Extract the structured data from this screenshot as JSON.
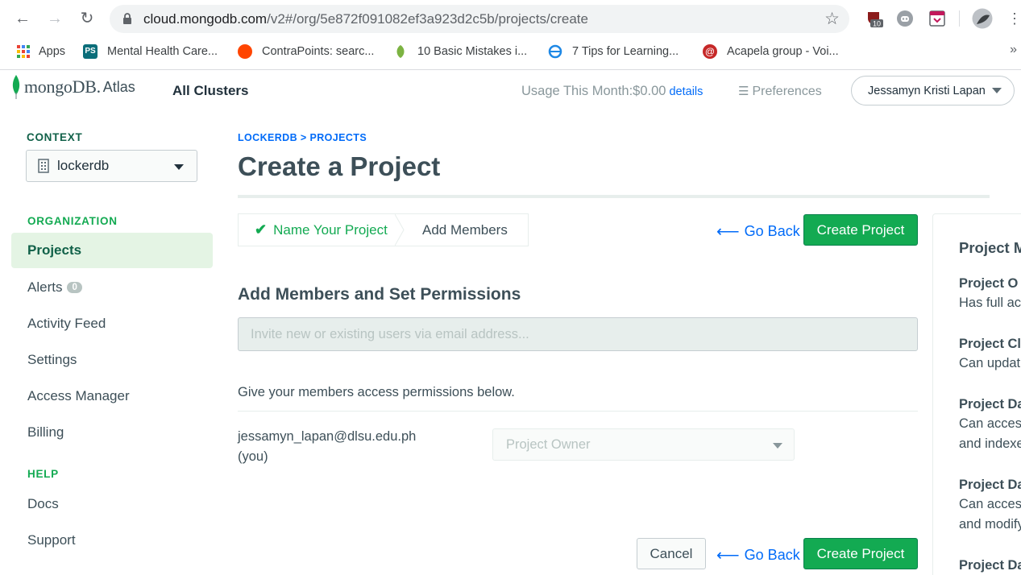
{
  "browser": {
    "url_host": "cloud.mongodb.com",
    "url_path": "/v2#/org/5e872f091082ef3a923d2c5b/projects/create",
    "ext_badge": "10",
    "bookmarks": [
      {
        "label": "Apps",
        "icon": "apps-grid-icon",
        "color": "#ea4335"
      },
      {
        "label": "Mental Health Care...",
        "icon": "ps-icon",
        "color": "#0b6e7a"
      },
      {
        "label": "ContraPoints: searc...",
        "icon": "reddit-icon",
        "color": "#ff4500"
      },
      {
        "label": "10 Basic Mistakes i...",
        "icon": "leaf-icon",
        "color": "#7cb342"
      },
      {
        "label": "7 Tips for Learning...",
        "icon": "globe-icon",
        "color": "#1e88e5"
      },
      {
        "label": "Acapela group - Voi...",
        "icon": "acapela-icon",
        "color": "#c62828"
      }
    ]
  },
  "header": {
    "logo_text": "mongoDB.",
    "logo_sub": "Atlas",
    "all_clusters": "All Clusters",
    "usage_label": "Usage This Month:$0.00",
    "usage_link": "details",
    "preferences": "Preferences",
    "user_name": "Jessamyn Kristi Lapan"
  },
  "sidebar": {
    "context_label": "CONTEXT",
    "org_name": "lockerdb",
    "organization_label": "ORGANIZATION",
    "items": [
      {
        "label": "Projects",
        "active": true
      },
      {
        "label": "Alerts",
        "badge": "0"
      },
      {
        "label": "Activity Feed"
      },
      {
        "label": "Settings"
      },
      {
        "label": "Access Manager"
      },
      {
        "label": "Billing"
      }
    ],
    "help_label": "HELP",
    "help_items": [
      {
        "label": "Docs"
      },
      {
        "label": "Support"
      }
    ]
  },
  "main": {
    "breadcrumb": "LOCKERDB > PROJECTS",
    "title": "Create a Project",
    "steps": [
      {
        "label": "Name Your Project",
        "done": true
      },
      {
        "label": "Add Members",
        "done": false
      }
    ],
    "go_back": "Go Back",
    "create_project": "Create Project",
    "cancel": "Cancel",
    "section_title": "Add Members and Set Permissions",
    "invite_placeholder": "Invite new or existing users via email address...",
    "permissions_text": "Give your members access permissions below.",
    "member_email": "jessamyn_lapan@dlsu.edu.ph",
    "member_you": "(you)",
    "member_role": "Project Owner"
  },
  "right_panel": {
    "title": "Project M",
    "roles": [
      {
        "name": "Project O",
        "desc": [
          "Has full ac"
        ]
      },
      {
        "name": "Project Cl",
        "desc": [
          "Can updat"
        ]
      },
      {
        "name": "Project Da",
        "desc": [
          "Can acces",
          "and indexe"
        ]
      },
      {
        "name": "Project Da",
        "desc": [
          "Can acces",
          "and modify"
        ]
      },
      {
        "name": "Project Da",
        "desc": []
      }
    ]
  },
  "colors": {
    "brand_green": "#13aa52",
    "link_blue": "#016bf8",
    "text": "#3d4f58"
  }
}
